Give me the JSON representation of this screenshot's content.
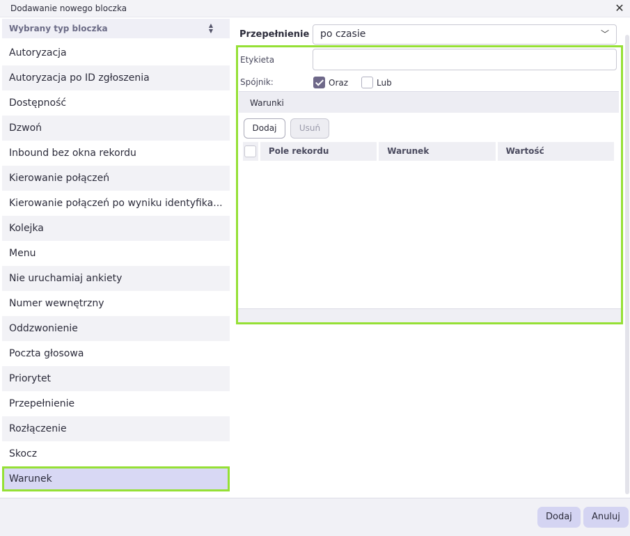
{
  "window": {
    "title": "Dodawanie nowego bloczka"
  },
  "sidebar": {
    "header_label": "Wybrany typ bloczka",
    "items": [
      "Autoryzacja",
      "Autoryzacja po ID zgłoszenia",
      "Dostępność",
      "Dzwoń",
      "Inbound bez okna rekordu",
      "Kierowanie połączeń",
      "Kierowanie połączeń po wyniku identyfika...",
      "Kolejka",
      "Menu",
      "Nie uruchamiaj ankiety",
      "Numer wewnętrzny",
      "Oddzwonienie",
      "Poczta głosowa",
      "Priorytet",
      "Przepełnienie",
      "Rozłączenie",
      "Skocz",
      "Warunek"
    ],
    "selected": "Warunek"
  },
  "main": {
    "overflow_label": "Przepełnienie",
    "overflow_value": "po czasie",
    "label_field": {
      "label": "Etykieta",
      "value": ""
    },
    "connector": {
      "label": "Spójnik:",
      "options": [
        {
          "label": "Oraz",
          "checked": true
        },
        {
          "label": "Lub",
          "checked": false
        }
      ]
    },
    "conditions": {
      "title": "Warunki",
      "add_label": "Dodaj",
      "remove_label": "Usuń",
      "columns": [
        "Pole rekordu",
        "Warunek",
        "Wartość"
      ]
    }
  },
  "footer": {
    "add_label": "Dodaj",
    "cancel_label": "Anuluj"
  },
  "colors": {
    "highlight": "#95e035",
    "accent": "#d4d4f2",
    "checkbox": "#6e6889"
  }
}
